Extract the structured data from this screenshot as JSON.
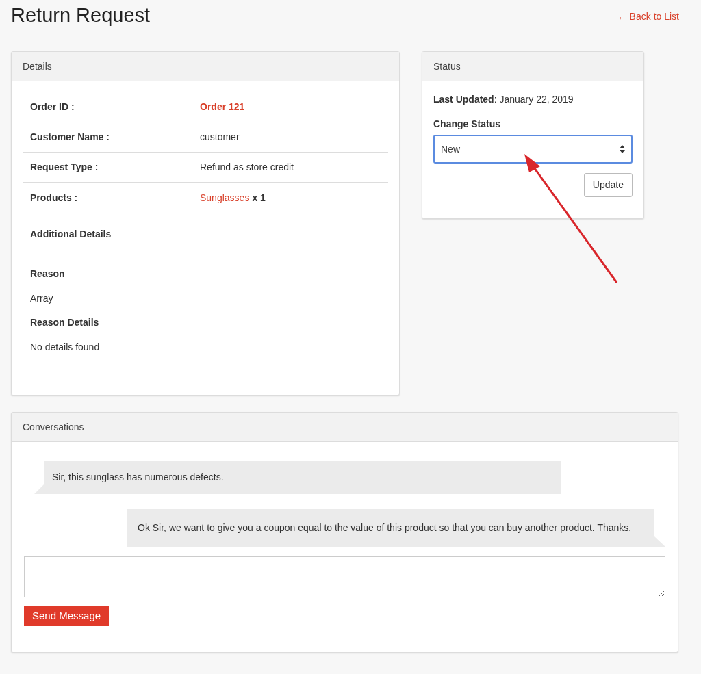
{
  "page": {
    "title": "Return Request",
    "back_link": "← Back to List"
  },
  "details": {
    "heading": "Details",
    "rows": [
      {
        "label": "Order ID :",
        "kind": "highlight",
        "value": "Order 121"
      },
      {
        "label": "Customer Name :",
        "kind": "text",
        "value": "customer"
      },
      {
        "label": "Request Type :",
        "kind": "text",
        "value": "Refund as store credit"
      },
      {
        "label": "Products :",
        "kind": "product",
        "value": "Sunglasses",
        "quantity": "x 1"
      }
    ],
    "additional_heading": "Additional Details",
    "fields": [
      {
        "label": "Reason",
        "value": "Array"
      },
      {
        "label": "Reason Details",
        "value": "No details found"
      }
    ]
  },
  "status": {
    "heading": "Status",
    "last_updated_label": "Last Updated",
    "last_updated_value": ": January 22, 2019",
    "change_label": "Change Status",
    "select_value": "New",
    "update_button": "Update"
  },
  "conversations": {
    "heading": "Conversations",
    "messages": [
      {
        "kind": "left",
        "text": "Sir, this sunglass has numerous defects."
      },
      {
        "kind": "right",
        "text": "Ok Sir, we want to give you a coupon equal to the value of this product so that you can buy another product. Thanks."
      }
    ],
    "send_button": "Send Message"
  }
}
